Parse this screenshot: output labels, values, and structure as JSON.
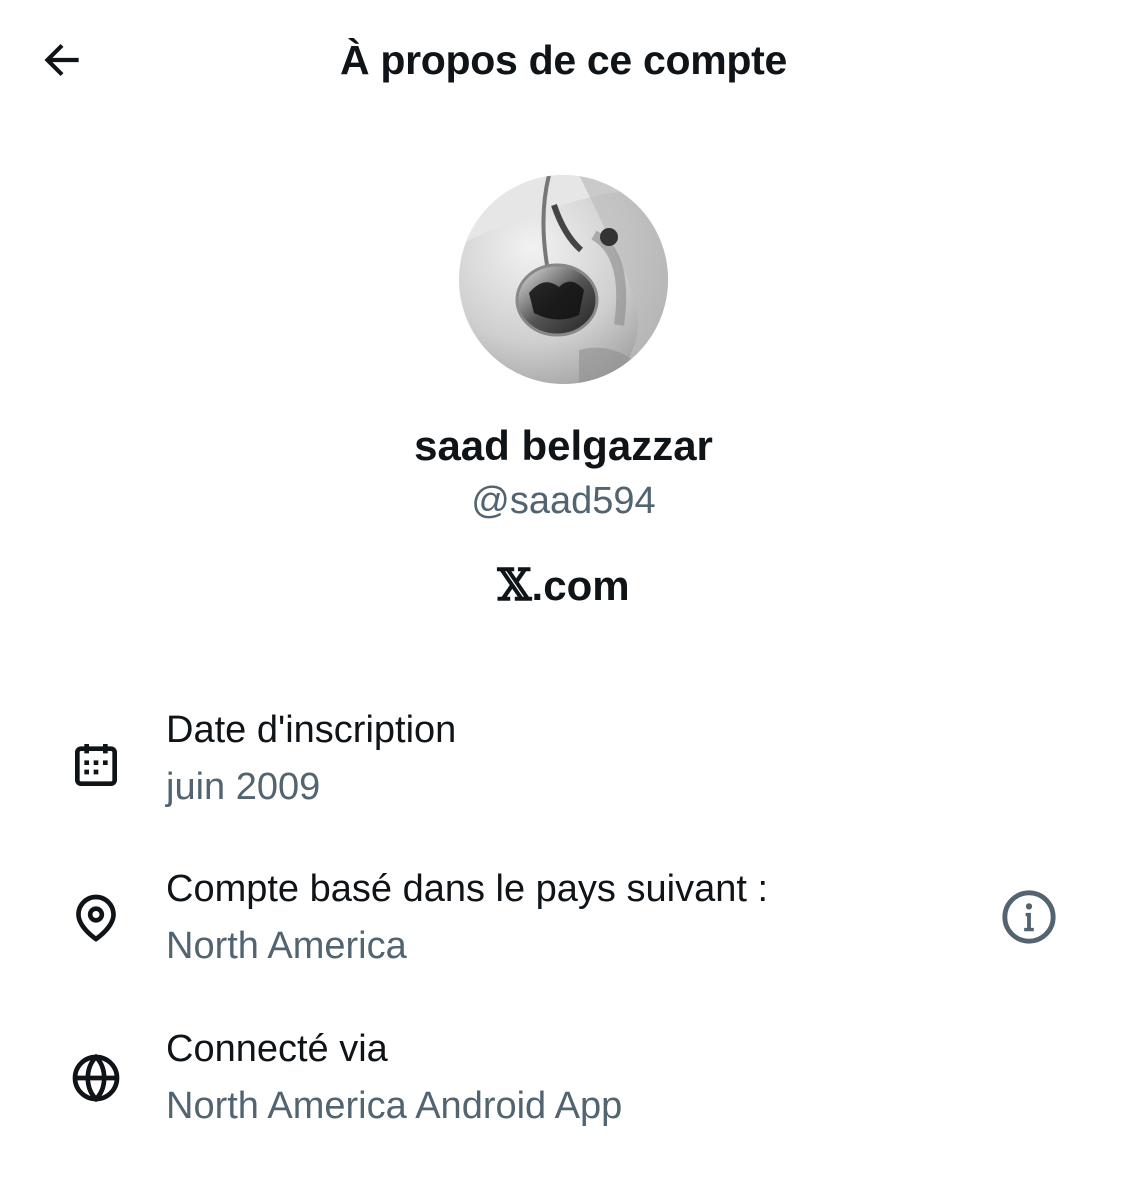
{
  "header": {
    "title": "À propos de ce compte",
    "back_icon": "arrow-left-icon"
  },
  "profile": {
    "display_name": "saad belgazzar",
    "handle": "@saad594",
    "platform_logo": "𝕏",
    "platform_suffix": ".com"
  },
  "details": [
    {
      "icon": "calendar-icon",
      "label": "Date d'inscription",
      "value": "juin 2009"
    },
    {
      "icon": "location-pin-icon",
      "label": "Compte basé dans le pays suivant :",
      "value": "North America",
      "action_icon": "info-icon"
    },
    {
      "icon": "globe-icon",
      "label": "Connecté via",
      "value": "North America Android App"
    }
  ],
  "colors": {
    "primary_text": "#0f1419",
    "secondary_text": "#536471",
    "background": "#ffffff"
  }
}
